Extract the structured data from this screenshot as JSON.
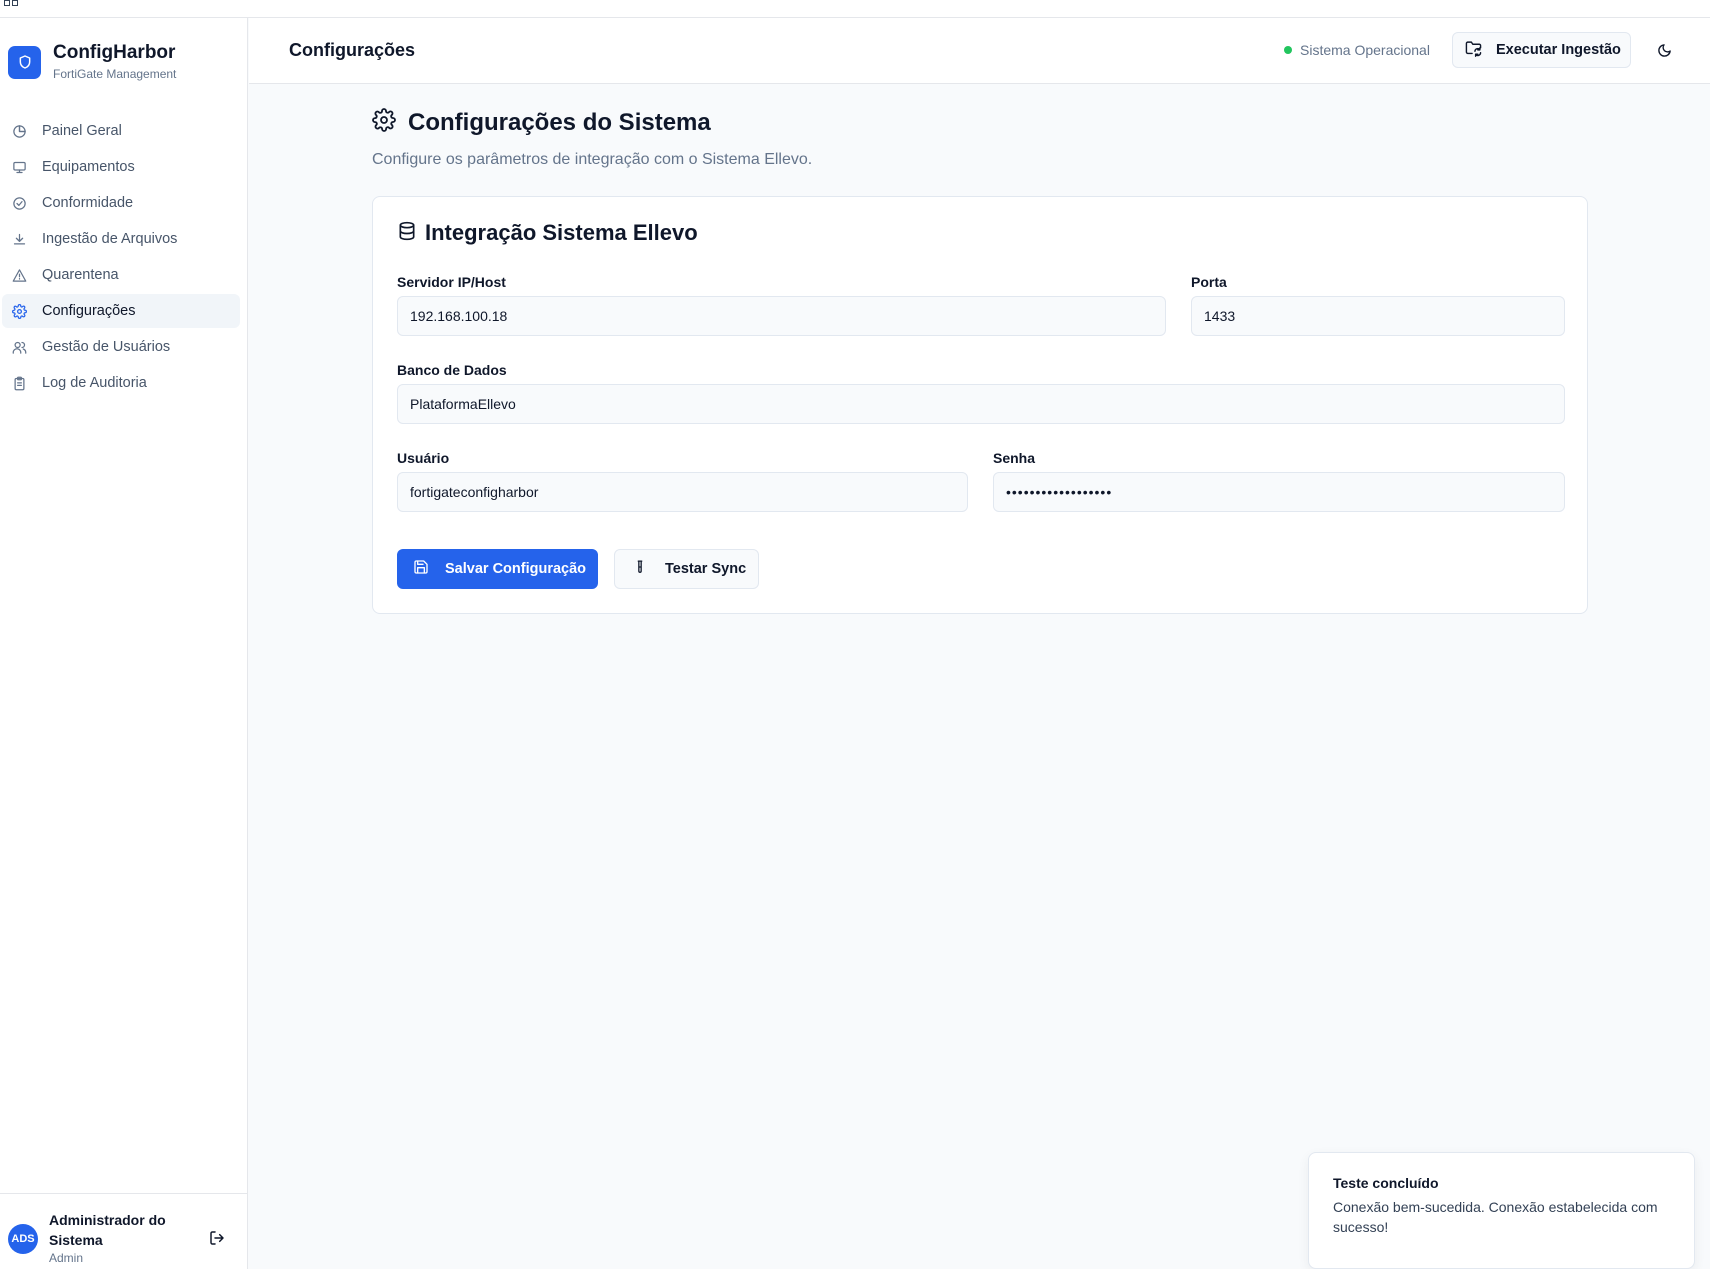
{
  "app": {
    "name": "ConfigHarbor",
    "subtitle": "FortiGate Management"
  },
  "sidebar": {
    "items": [
      {
        "label": "Painel Geral",
        "icon": "pie-chart-icon"
      },
      {
        "label": "Equipamentos",
        "icon": "monitor-icon"
      },
      {
        "label": "Conformidade",
        "icon": "check-circle-icon"
      },
      {
        "label": "Ingestão de Arquivos",
        "icon": "download-icon"
      },
      {
        "label": "Quarentena",
        "icon": "warning-triangle-icon"
      },
      {
        "label": "Configurações",
        "icon": "gear-icon",
        "active": true
      },
      {
        "label": "Gestão de Usuários",
        "icon": "users-icon"
      },
      {
        "label": "Log de Auditoria",
        "icon": "clipboard-icon"
      }
    ]
  },
  "user": {
    "initials": "ADS",
    "name": "Administrador do Sistema",
    "role": "Admin"
  },
  "header": {
    "title": "Configurações",
    "status": "Sistema Operacional",
    "status_color": "#22c55e",
    "ingest_label": "Executar Ingestão"
  },
  "main": {
    "title": "Configurações do Sistema",
    "description": "Configure os parâmetros de integração com o Sistema Ellevo."
  },
  "card": {
    "title": "Integração Sistema Ellevo",
    "fields": {
      "server": {
        "label": "Servidor IP/Host",
        "value": "192.168.100.18"
      },
      "port": {
        "label": "Porta",
        "value": "1433"
      },
      "database": {
        "label": "Banco de Dados",
        "value": "PlataformaEllevo"
      },
      "user": {
        "label": "Usuário",
        "value": "fortigateconfigharbor"
      },
      "password": {
        "label": "Senha",
        "value": "••••••••••••••••••"
      }
    },
    "save_label": "Salvar Configuração",
    "test_label": "Testar Sync"
  },
  "toast": {
    "title": "Teste concluído",
    "message": "Conexão bem-sucedida. Conexão estabelecida com sucesso!"
  },
  "colors": {
    "accent": "#2563eb"
  }
}
